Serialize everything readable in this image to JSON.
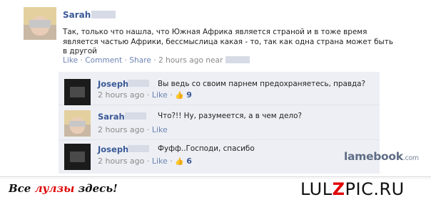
{
  "post": {
    "author": "Sarah",
    "text": "Так, только что нашла, что Южная  Африка является страной и в тоже время является частью Африки, бессмыслица какая - то, так как одна страна может быть в другой",
    "like": "Like",
    "comment": "Comment",
    "share": "Share",
    "time": "2 hours ago near",
    "dot": "·"
  },
  "comments": [
    {
      "author": "Joseph",
      "text": "Вы ведь со своим парнем предохраняетесь, правда?",
      "time": "2 hours ago",
      "like": "Like",
      "likes": "9"
    },
    {
      "author": "Sarah",
      "text": "Что?!! Ну, разумеется, а в чем дело?",
      "time": "2 hours ago",
      "like": "Like",
      "likes": ""
    },
    {
      "author": "Joseph",
      "text": "Фуфф..Господи, спасибо",
      "time": "2 hours ago",
      "like": "Like",
      "likes": "6"
    }
  ],
  "watermark": {
    "main": "lamebook",
    "suffix": ".com"
  },
  "footer": {
    "left_a": "Все ",
    "left_red": "лулзы",
    "left_b": " здесь!",
    "right_a": "LUL",
    "right_red": "Z",
    "right_b": "PIC.RU"
  },
  "icons": {
    "thumb": "thumbs-up-icon"
  },
  "colors": {
    "link": "#3b5998",
    "accent_red": "#e00000"
  }
}
